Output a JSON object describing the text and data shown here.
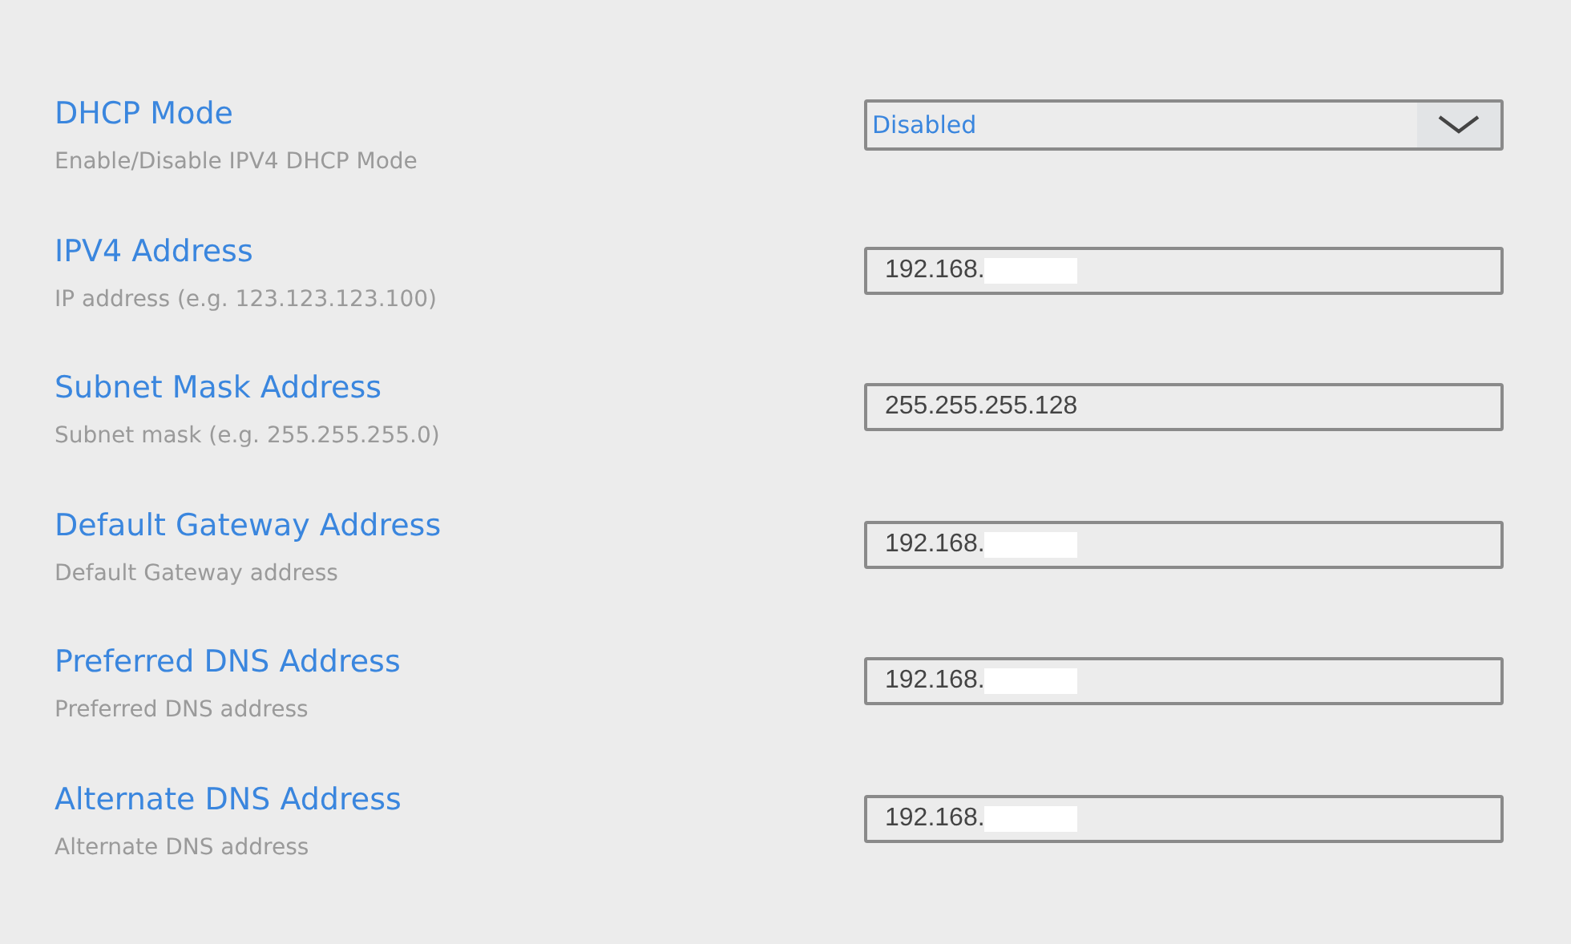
{
  "settings": [
    {
      "label": "DHCP Mode",
      "hint": "Enable/Disable IPV4 DHCP Mode",
      "kind": "select",
      "value": "Disabled"
    },
    {
      "label": "IPV4 Address",
      "hint": "IP address (e.g. 123.123.123.100)",
      "kind": "text",
      "value": "192.168.",
      "redacted": true
    },
    {
      "label": "Subnet Mask Address",
      "hint": "Subnet mask (e.g. 255.255.255.0)",
      "kind": "text",
      "value": "255.255.255.128",
      "redacted": false
    },
    {
      "label": "Default Gateway Address",
      "hint": "Default Gateway address",
      "kind": "text",
      "value": "192.168.",
      "redacted": true
    },
    {
      "label": "Preferred DNS Address",
      "hint": "Preferred DNS address",
      "kind": "text",
      "value": "192.168.",
      "redacted": true
    },
    {
      "label": "Alternate DNS Address",
      "hint": "Alternate DNS address",
      "kind": "text",
      "value": "192.168.",
      "redacted": true
    }
  ]
}
